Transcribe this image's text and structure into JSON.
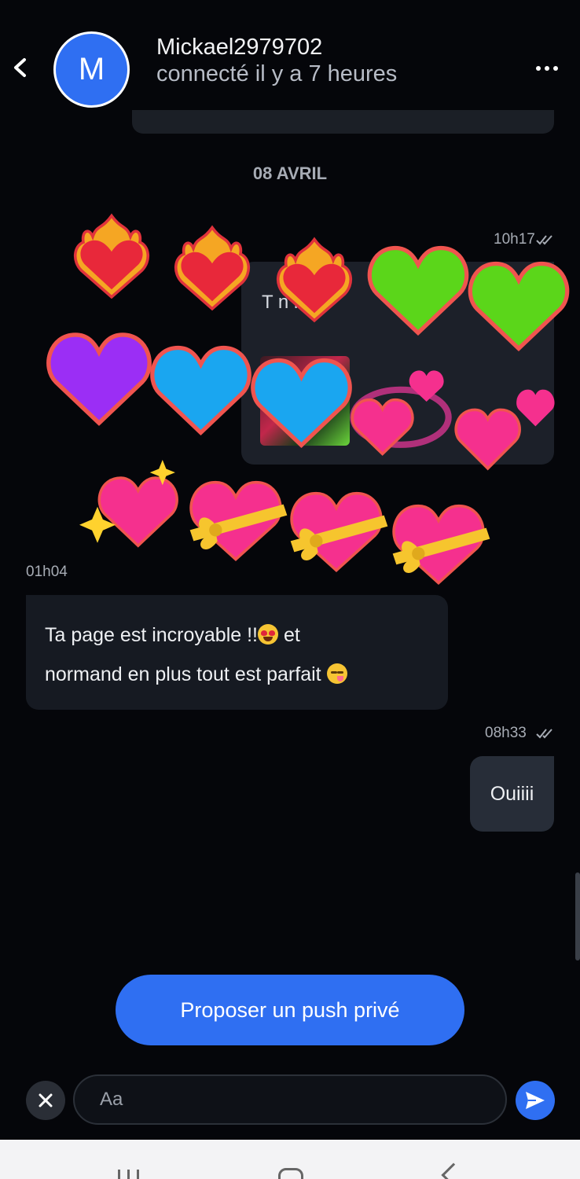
{
  "header": {
    "contact_name": "Mickael2979702",
    "contact_status": "connecté il y a 7 heures",
    "avatar_letter": "M",
    "back_icon": "chevron-left-icon",
    "more_icon": "more-horizontal-icon"
  },
  "conversation": {
    "date_separator": "08 AVRIL",
    "shared_post": {
      "time": "10h17",
      "read_icon": "double-check-icon",
      "caption_partial": "T      n  n              o"
    },
    "incoming": {
      "time": "01h04",
      "line1": "Ta page est incroyable !!",
      "line1_after": " et",
      "line2": "normand en plus tout est parfait ",
      "emoji_1": "smiling-face-with-heart-eyes",
      "emoji_2": "face-savoring-food"
    },
    "outgoing": {
      "time": "08h33",
      "read_icon": "double-check-icon",
      "text": "Ouiiii"
    }
  },
  "reactions": {
    "row1": [
      "heart-on-fire",
      "heart-on-fire",
      "heart-on-fire",
      "green-heart",
      "green-heart"
    ],
    "row2": [
      "purple-heart",
      "blue-heart",
      "blue-heart",
      "revolving-hearts",
      "two-hearts"
    ],
    "row3": [
      "sparkling-heart",
      "heart-with-ribbon",
      "heart-with-ribbon",
      "heart-with-ribbon"
    ]
  },
  "actions": {
    "push_button": "Proposer un push privé"
  },
  "composer": {
    "placeholder": "Aa",
    "close_icon": "close-icon",
    "send_icon": "send-icon"
  },
  "colors": {
    "accent": "#2f6ff2",
    "background": "#05060a",
    "bubble_in": "#161a22",
    "bubble_out": "#272d38"
  }
}
